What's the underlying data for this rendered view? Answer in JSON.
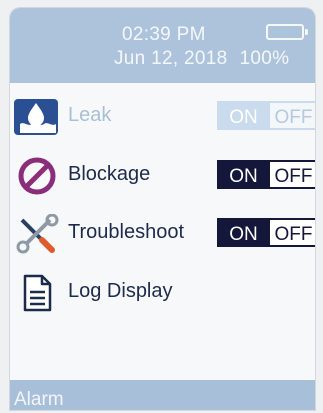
{
  "status": {
    "time": "02:39 PM",
    "date": "Jun 12, 2018",
    "battery_percent": "100%"
  },
  "settings": [
    {
      "label": "Leak",
      "on_label": "ON",
      "off_label": "OFF",
      "state": "on",
      "enabled": false,
      "icon": "water-drop-icon"
    },
    {
      "label": "Blockage",
      "on_label": "ON",
      "off_label": "OFF",
      "state": "on",
      "enabled": true,
      "icon": "prohibited-icon"
    },
    {
      "label": "Troubleshoot",
      "on_label": "ON",
      "off_label": "OFF",
      "state": "on",
      "enabled": true,
      "icon": "tools-icon"
    }
  ],
  "log": {
    "label": "Log Display",
    "icon": "document-icon"
  },
  "footer": {
    "label": "Alarm"
  },
  "colors": {
    "header_bg": "#adc3dc",
    "toggle_active": "#14163a",
    "text": "#1d2b4a",
    "disabled_text": "#a8bfd7",
    "prohibited_icon": "#8a2d7a"
  }
}
